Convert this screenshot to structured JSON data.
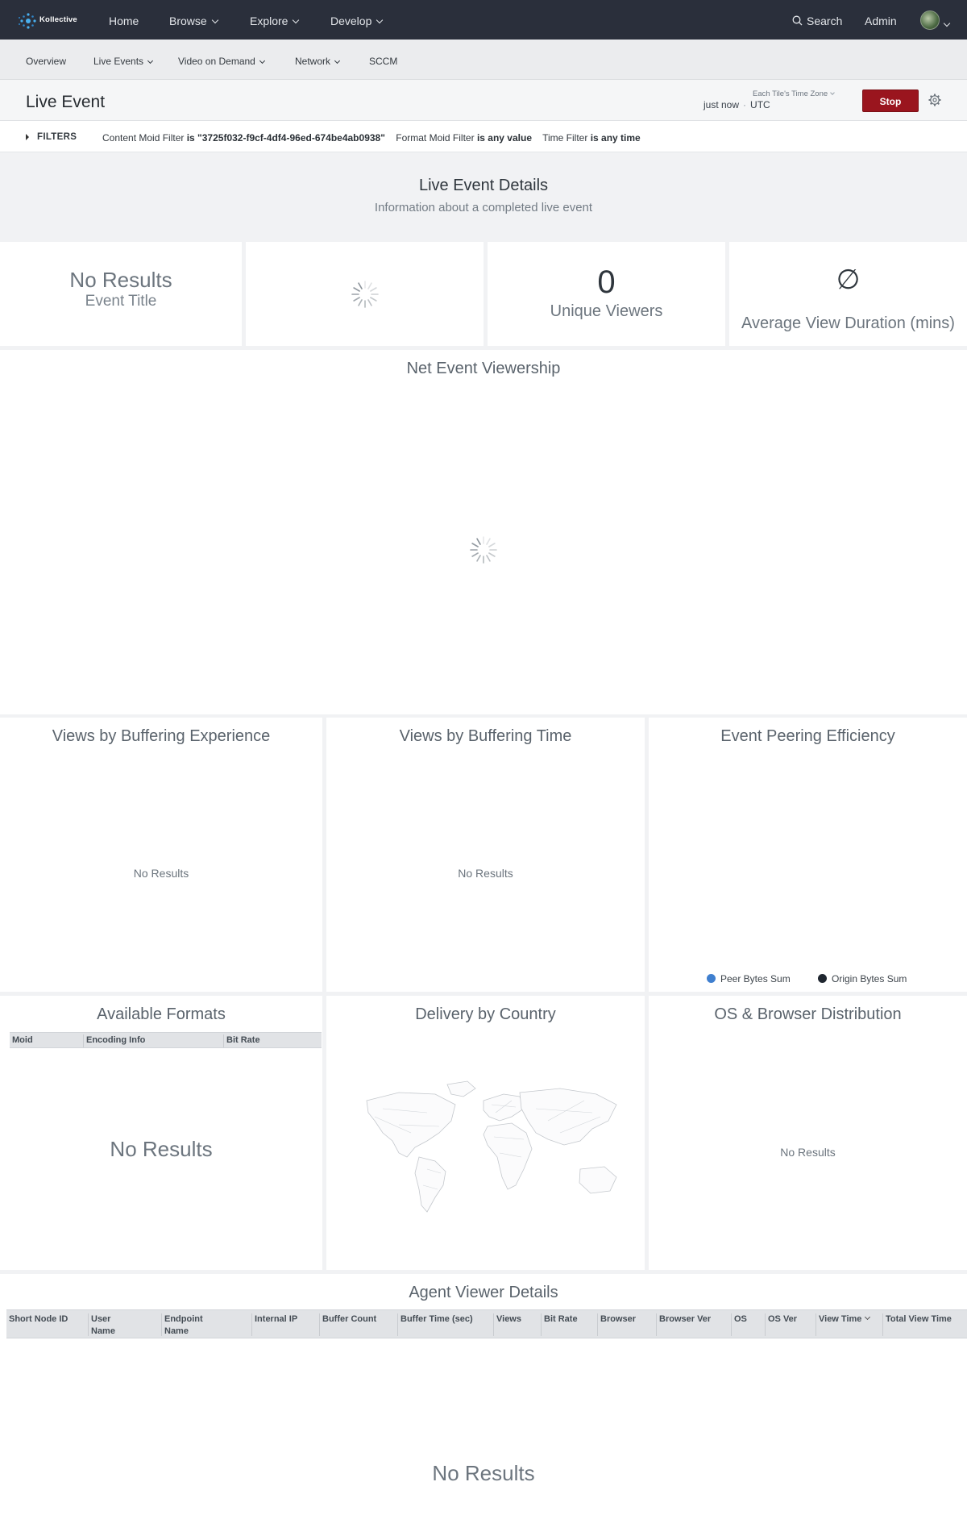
{
  "brand": {
    "name": "Kollective"
  },
  "topnav": {
    "items": [
      {
        "label": "Home",
        "has_menu": false
      },
      {
        "label": "Browse",
        "has_menu": true
      },
      {
        "label": "Explore",
        "has_menu": true
      },
      {
        "label": "Develop",
        "has_menu": true
      }
    ],
    "search_label": "Search",
    "admin_label": "Admin",
    "search_icon": "search-icon",
    "avatar_icon": "user-avatar"
  },
  "subnav": {
    "items": [
      {
        "label": "Overview",
        "has_menu": false
      },
      {
        "label": "Live Events",
        "has_menu": true
      },
      {
        "label": "Video on Demand",
        "has_menu": true
      },
      {
        "label": "Network",
        "has_menu": true
      },
      {
        "label": "SCCM",
        "has_menu": false
      }
    ]
  },
  "titlebar": {
    "title": "Live Event",
    "tz_label": "Each Tile's Time Zone",
    "updated": "just now",
    "timezone": "UTC",
    "stop_label": "Stop",
    "stop_color": "#9a151e",
    "settings_icon": "gear-icon"
  },
  "filters": {
    "title": "FILTERS",
    "items": [
      {
        "name": "Content Moid Filter",
        "value": "is \"3725f032-f9cf-4df4-96ed-674be4ab0938\""
      },
      {
        "name": "Format Moid Filter",
        "value": "is any value"
      },
      {
        "name": "Time Filter",
        "value": "is any time"
      }
    ]
  },
  "details": {
    "title": "Live Event Details",
    "subtitle": "Information about a completed live event"
  },
  "kpis": {
    "event_title": {
      "value": "No Results",
      "label": "Event Title"
    },
    "unique_viewers": {
      "value": "0",
      "label": "Unique Viewers"
    },
    "avg_view_duration": {
      "value": "∅",
      "label": "Average View Duration (mins)"
    }
  },
  "viewership": {
    "title": "Net Event Viewership"
  },
  "buffering_experience": {
    "title": "Views by Buffering Experience",
    "empty": "No Results"
  },
  "buffering_time": {
    "title": "Views by Buffering Time",
    "empty": "No Results"
  },
  "peering": {
    "title": "Event Peering Efficiency",
    "legend": [
      {
        "label": "Peer Bytes Sum",
        "color": "#3f7fcf"
      },
      {
        "label": "Origin Bytes Sum",
        "color": "#1f2630"
      }
    ]
  },
  "formats": {
    "title": "Available Formats",
    "columns": [
      "Moid",
      "Encoding Info",
      "Bit Rate"
    ],
    "empty": "No Results"
  },
  "country": {
    "title": "Delivery by Country"
  },
  "os_browser": {
    "title": "OS & Browser Distribution",
    "empty": "No Results"
  },
  "agents": {
    "title": "Agent Viewer Details",
    "columns": [
      "Short Node ID",
      "User Name",
      "Endpoint Name",
      "Internal IP",
      "Buffer Count",
      "Buffer Time (sec)",
      "Views",
      "Bit Rate",
      "Browser",
      "Browser Ver",
      "OS",
      "OS Ver",
      "View Time",
      "Total View Time"
    ],
    "sorted_column": "View Time",
    "empty": "No Results"
  }
}
